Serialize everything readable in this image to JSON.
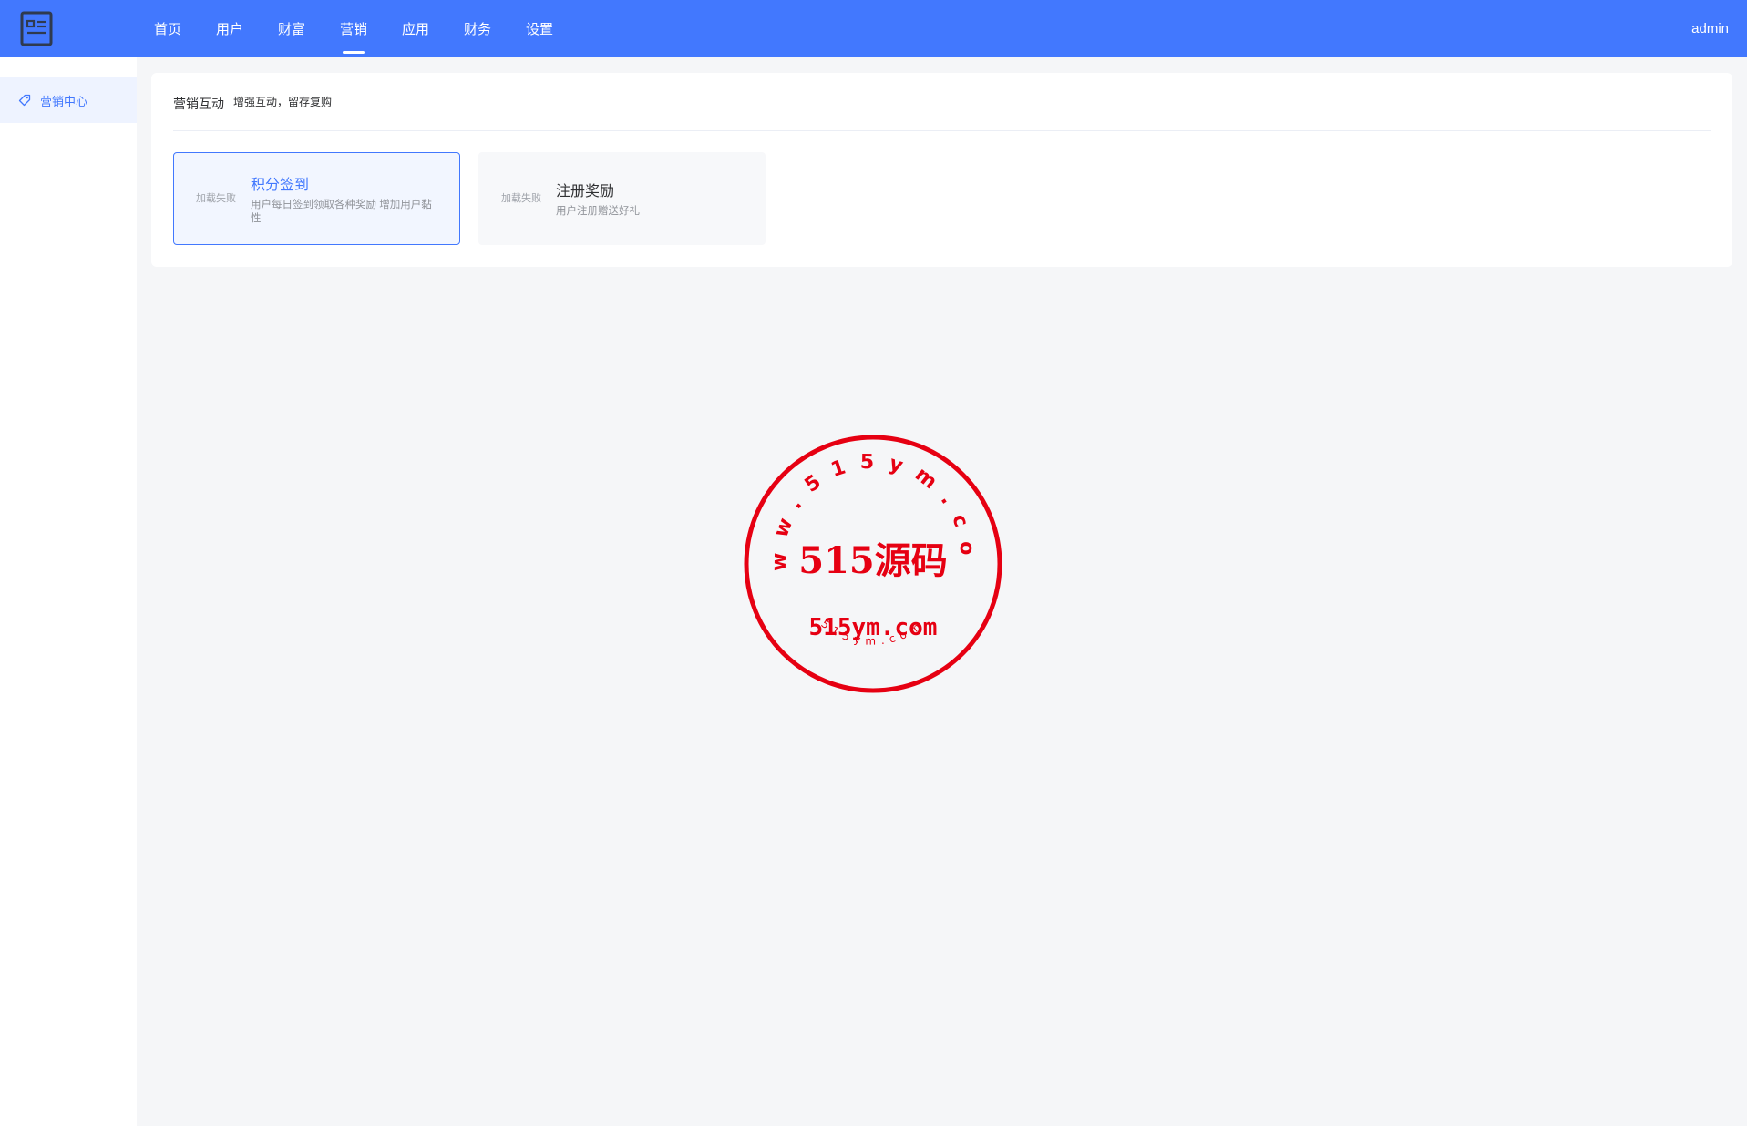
{
  "header": {
    "nav": [
      "首页",
      "用户",
      "财富",
      "营销",
      "应用",
      "财务",
      "设置"
    ],
    "active_index": 3,
    "user": "admin"
  },
  "sidebar": {
    "items": [
      {
        "label": "营销中心",
        "icon": "tag-icon",
        "active": true
      }
    ]
  },
  "main": {
    "section_title": "营销互动",
    "section_subtitle": "增强互动，留存复购",
    "tools": [
      {
        "image_alt": "加载失败",
        "name": "积分签到",
        "desc": "用户每日签到领取各种奖励 增加用户黏性",
        "active": true
      },
      {
        "image_alt": "加载失败",
        "name": "注册奖励",
        "desc": "用户注册赠送好礼",
        "active": false
      }
    ]
  },
  "stamp": {
    "ring_text": "www.515ym.com",
    "main_text": "515源码",
    "domain_text": "515ym.com",
    "bottom_text": "515ym.com",
    "color": "#e60012"
  },
  "colors": {
    "primary": "#4278fe",
    "background": "#f5f6f8"
  }
}
